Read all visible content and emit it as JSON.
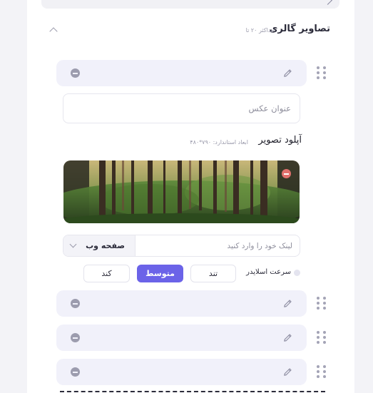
{
  "gallery": {
    "title": "تصاویر گالری",
    "subtitle": "حداکثر ۲۰ تا"
  },
  "caption_field": {
    "placeholder": "عنوان عکس",
    "value": ""
  },
  "upload": {
    "label": "آپلود تصویر",
    "hint": "ابعاد استاندارد: ۷۹۰*۴۸۰"
  },
  "link": {
    "placeholder": "لینک خود را وارد کنید",
    "value": "",
    "type_selected": "صفحه وب"
  },
  "slider_speed": {
    "label": "سرعت اسلایدر",
    "options": [
      "تند",
      "متوسط",
      "کند"
    ],
    "selected": "متوسط"
  },
  "colors": {
    "accent": "#6b63e8",
    "item_bg": "#f1f1fa",
    "remove_red": "#e0706d"
  }
}
